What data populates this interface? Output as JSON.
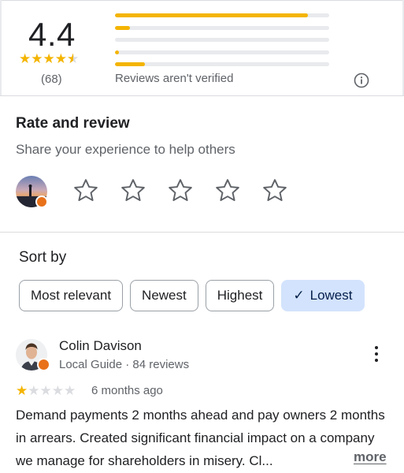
{
  "summary": {
    "score": "4.4",
    "stars": 4.5,
    "count": "(68)",
    "distribution": [
      0.9,
      0.07,
      0,
      0.02,
      0.14
    ],
    "not_verified": "Reviews aren't verified",
    "info_icon": "info-icon"
  },
  "rate": {
    "title": "Rate and review",
    "subtitle": "Share your experience to help others",
    "avatar_icon": "user-avatar",
    "stars": 5
  },
  "sort": {
    "label": "Sort by",
    "chips": [
      {
        "label": "Most relevant",
        "selected": false
      },
      {
        "label": "Newest",
        "selected": false
      },
      {
        "label": "Highest",
        "selected": false
      },
      {
        "label": "Lowest",
        "selected": true
      }
    ]
  },
  "review": {
    "name": "Colin Davison",
    "meta": "Local Guide · 84 reviews",
    "rating": 1,
    "date": "6 months ago",
    "text": "Demand payments 2 months ahead and pay owners 2 months in arrears. Created significant financial impact on a company we manage for shareholders in misery. Cl...",
    "more": "more"
  },
  "colors": {
    "star": "#f4b400",
    "star_empty": "#dadce0",
    "chip_selected": "#d3e3fd",
    "badge": "#e8711a"
  }
}
